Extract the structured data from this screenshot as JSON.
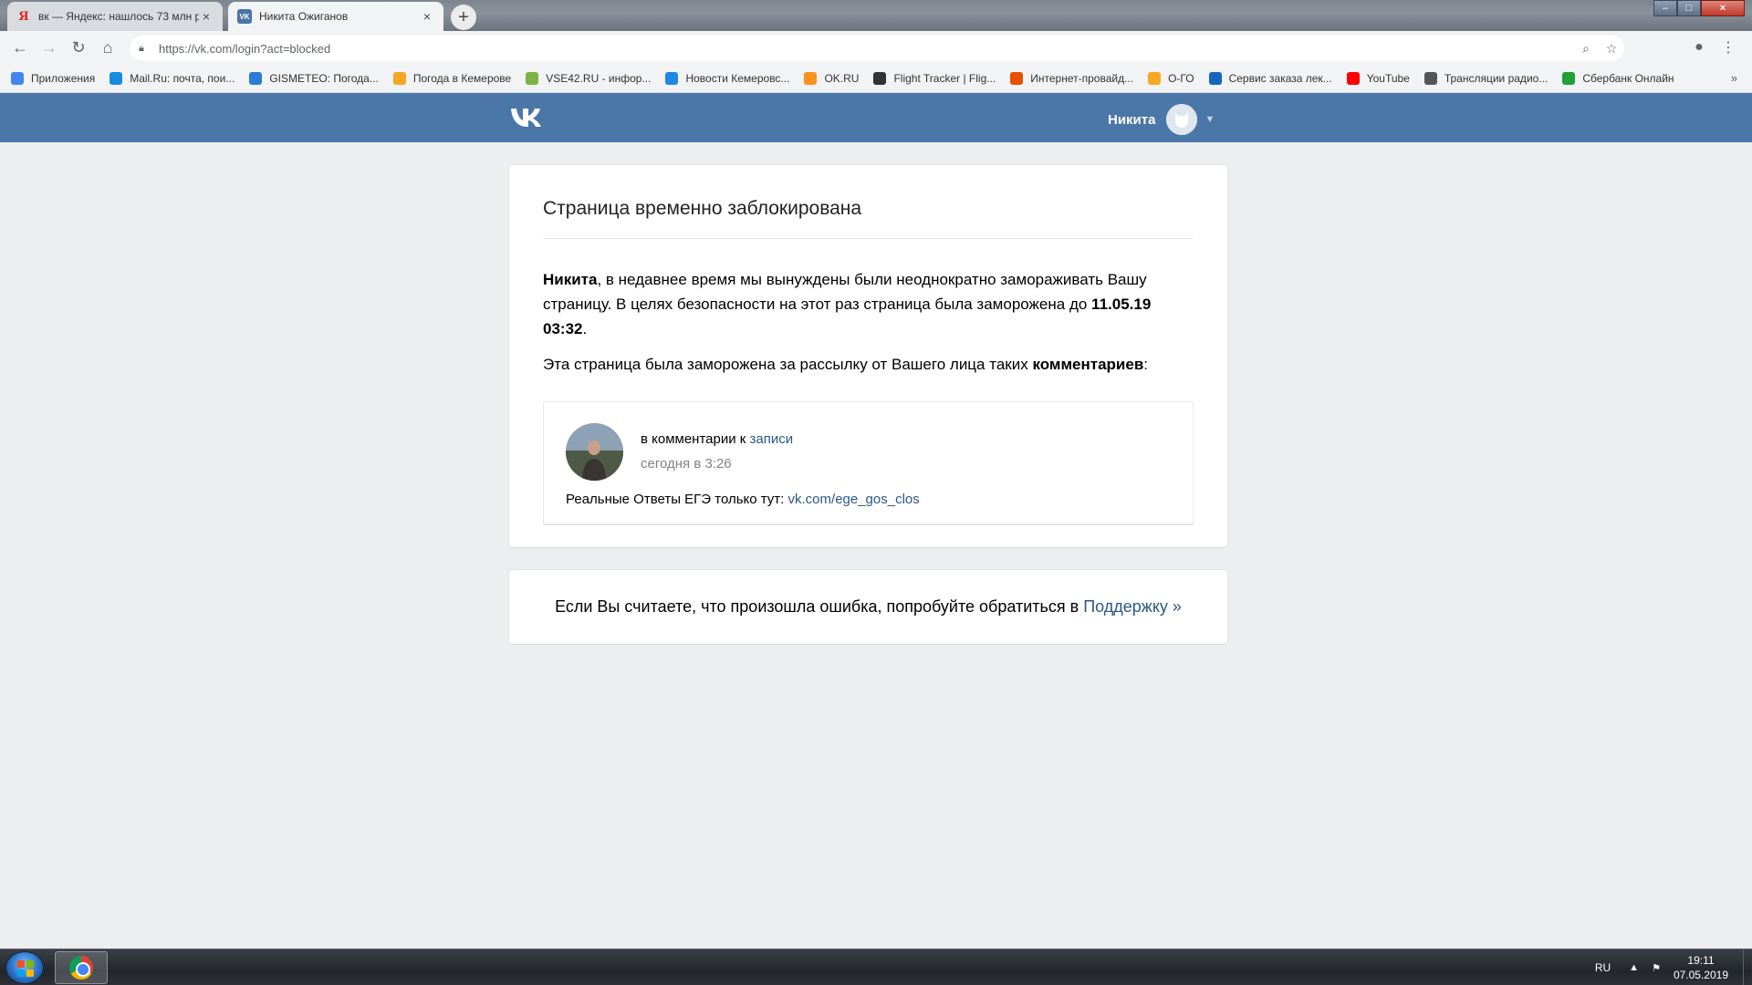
{
  "browser": {
    "tabs": [
      {
        "title": "вк — Яндекс: нашлось 73 млн р",
        "favicon": "yandex-icon",
        "close": "×"
      },
      {
        "title": "Никита Ожиганов",
        "favicon": "vk-icon",
        "close": "×"
      }
    ],
    "new_tab": "+",
    "url": "https://vk.com/login?act=blocked",
    "bookmarks": [
      {
        "label": "Приложения",
        "icon": "apps-grid-icon",
        "color": "#4285f4"
      },
      {
        "label": "Mail.Ru: почта, пои...",
        "icon": "mailru-icon",
        "color": "#168de2"
      },
      {
        "label": "GISMETEO: Погода...",
        "icon": "gismeteo-icon",
        "color": "#2b7bd6"
      },
      {
        "label": "Погода в Кемерове",
        "icon": "weather-icon",
        "color": "#f5a623"
      },
      {
        "label": "VSE42.RU - инфор...",
        "icon": "vse42-icon",
        "color": "#7cb342"
      },
      {
        "label": "Новости Кемеровс...",
        "icon": "news-icon",
        "color": "#1e88e5"
      },
      {
        "label": "OK.RU",
        "icon": "ok-icon",
        "color": "#f7931e"
      },
      {
        "label": "Flight Tracker | Flig...",
        "icon": "flight-tracker-icon",
        "color": "#333333"
      },
      {
        "label": "Интернет-провайд...",
        "icon": "provider-icon",
        "color": "#e65100"
      },
      {
        "label": "О-ГО",
        "icon": "ogo-icon",
        "color": "#f9a825"
      },
      {
        "label": "Сервис заказа лек...",
        "icon": "pharmacy-icon",
        "color": "#1565c0"
      },
      {
        "label": "YouTube",
        "icon": "youtube-icon",
        "color": "#ff0000"
      },
      {
        "label": "Трансляции радио...",
        "icon": "radio-icon",
        "color": "#555555"
      },
      {
        "label": "Сбербанк Онлайн",
        "icon": "sberbank-icon",
        "color": "#21a038"
      }
    ],
    "bookmarks_more": "»"
  },
  "vk": {
    "logo": "VK",
    "user_name": "Никита",
    "colors": {
      "header": "#4a76a8",
      "link": "#2a5885",
      "background": "#edeef0"
    }
  },
  "blocked": {
    "title": "Страница временно заблокирована",
    "p1_name": "Никита",
    "p1_text": ", в недавнее время мы вынуждены были неоднократно замораживать Вашу страницу. В целях безопасности на этот раз страница была заморожена до ",
    "p1_date": "11.05.19 03:32",
    "p1_end": ".",
    "p2_text": "Эта страница была заморожена за рассылку от Вашего лица таких ",
    "p2_bold": "комментариев",
    "p2_end": ":",
    "comment": {
      "prefix": "в комментарии к ",
      "link": "записи",
      "time": "сегодня в 3:26",
      "text": "Реальные Ответы ЕГЭ только тут: ",
      "text_link": "vk.com/ege_gos_clos"
    }
  },
  "support": {
    "text": "Если Вы считаете, что произошла ошибка, попробуйте обратиться в ",
    "link": "Поддержку »"
  },
  "taskbar": {
    "lang": "RU",
    "time": "19:11",
    "date": "07.05.2019"
  }
}
